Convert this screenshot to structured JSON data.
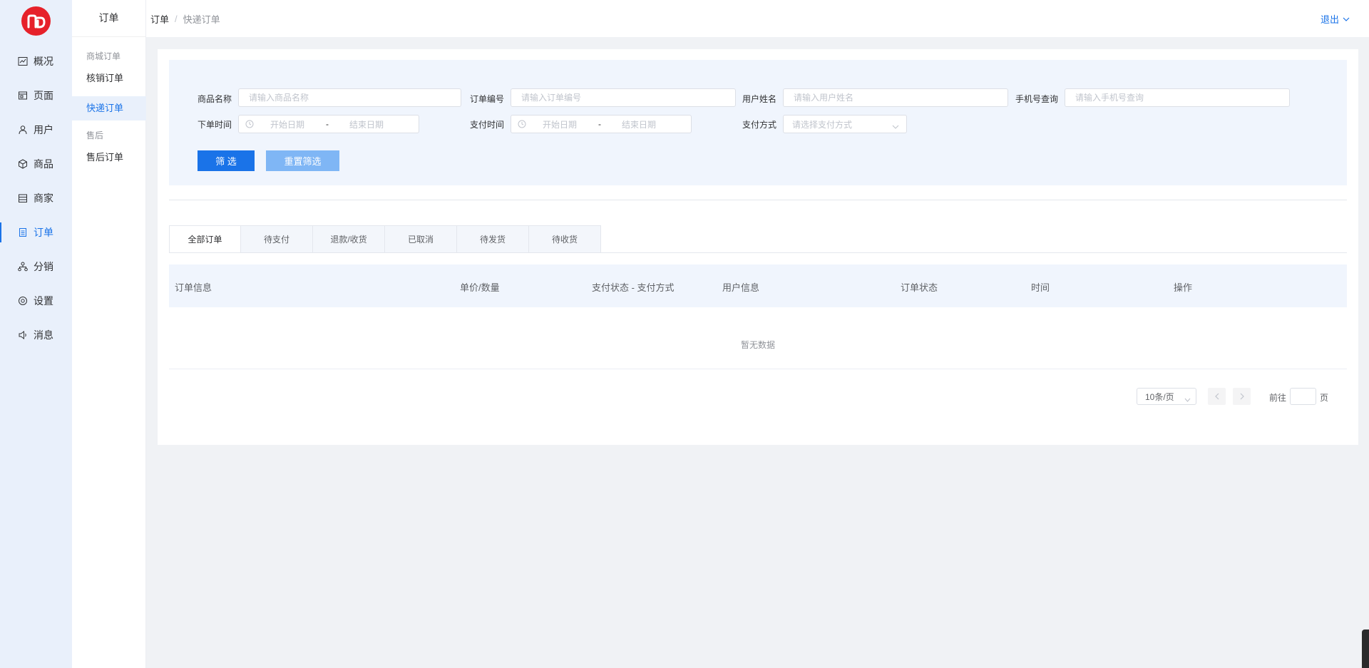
{
  "nav": {
    "items": [
      {
        "label": "概况",
        "icon": "chart-line-icon"
      },
      {
        "label": "页面",
        "icon": "page-icon"
      },
      {
        "label": "用户",
        "icon": "user-icon"
      },
      {
        "label": "商品",
        "icon": "cube-icon"
      },
      {
        "label": "商家",
        "icon": "store-icon"
      },
      {
        "label": "订单",
        "icon": "order-icon"
      },
      {
        "label": "分销",
        "icon": "network-icon"
      },
      {
        "label": "设置",
        "icon": "settings-icon"
      },
      {
        "label": "消息",
        "icon": "speaker-icon"
      }
    ],
    "active_index": 5
  },
  "sub_nav": {
    "title": "订单",
    "group1": "商城订单",
    "link1": "核销订单",
    "link2": "快递订单",
    "group2": "售后",
    "link3": "售后订单"
  },
  "header": {
    "crumb1": "订单",
    "crumb_sep": "/",
    "crumb2": "快递订单",
    "logout": "退出"
  },
  "filters": {
    "product_name_label": "商品名称",
    "product_name_placeholder": "请输入商品名称",
    "order_no_label": "订单编号",
    "order_no_placeholder": "请输入订单编号",
    "user_name_label": "用户姓名",
    "user_name_placeholder": "请输入用户姓名",
    "phone_label": "手机号查询",
    "phone_placeholder": "请输入手机号查询",
    "order_time_label": "下单时间",
    "pay_time_label": "支付时间",
    "start_date": "开始日期",
    "range_sep": "-",
    "end_date": "结束日期",
    "pay_method_label": "支付方式",
    "pay_method_placeholder": "请选择支付方式",
    "filter_button": "筛 选",
    "reset_button": "重置筛选"
  },
  "tabs": [
    "全部订单",
    "待支付",
    "退款/收货",
    "已取消",
    "待发货",
    "待收货"
  ],
  "table": {
    "headers": [
      "订单信息",
      "单价/数量",
      "支付状态 - 支付方式",
      "用户信息",
      "订单状态",
      "时间",
      "操作"
    ],
    "empty_text": "暂无数据"
  },
  "pagination": {
    "page_size": "10条/页",
    "goto_label": "前往",
    "page_suffix": "页"
  },
  "colors": {
    "accent": "#1a73e8",
    "logo": "#e6212a"
  }
}
